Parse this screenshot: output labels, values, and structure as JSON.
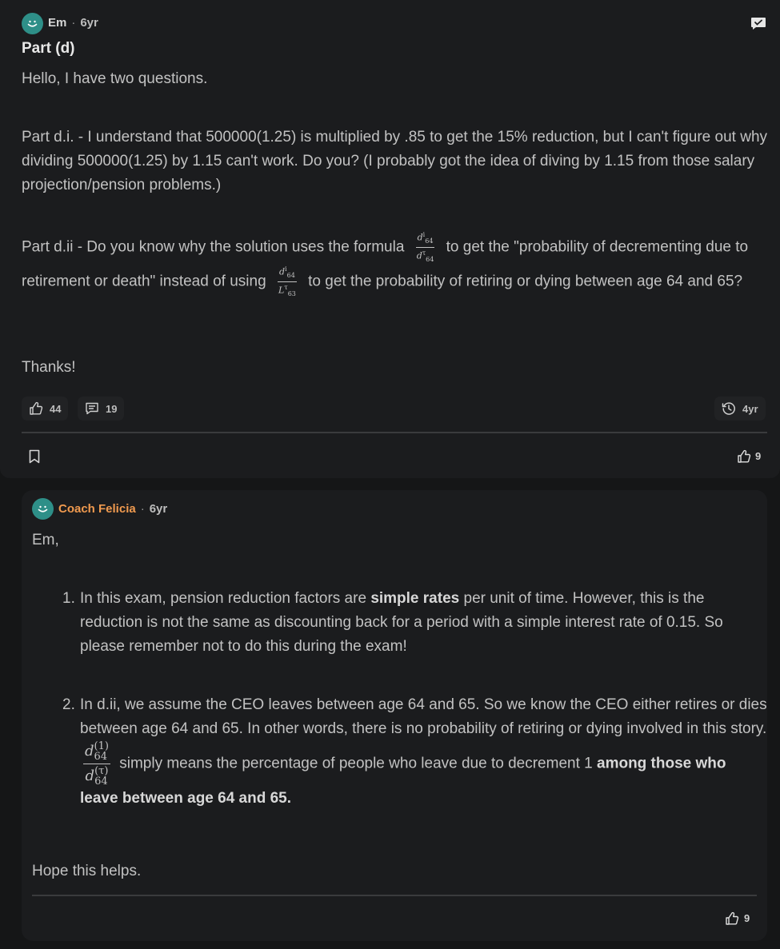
{
  "post": {
    "author": "Em",
    "age": "6yr",
    "title": "Part (d)",
    "greeting": "Hello, I have two questions.",
    "part_i": "Part d.i. - I understand that 500000(1.25) is multiplied by .85 to get the 15% reduction, but I can't figure out why dividing 500000(1.25) by 1.15 can't work. Do you? (I probably got the idea of diving by 1.15 from those salary projection/pension problems.)",
    "part_ii_a": "Part d.ii - Do you know why the solution uses the formula",
    "part_ii_b": "to get the \"probability of decrementing due to retirement or death\" instead of using",
    "part_ii_c": "to get the probability of retiring or dying between age 64 and 65?",
    "formula1_num": "d",
    "formula1_num_sup": "i",
    "formula1_num_sub": "64",
    "formula1_den": "d",
    "formula1_den_sup": "τ",
    "formula1_den_sub": "64",
    "formula2_num": "d",
    "formula2_num_sup": "i",
    "formula2_num_sub": "64",
    "formula2_den": "L",
    "formula2_den_sup": "τ",
    "formula2_den_sub": "63",
    "thanks": "Thanks!",
    "likes": "44",
    "comments": "19",
    "last_activity": "4yr",
    "bottom_likes": "9"
  },
  "reply": {
    "author": "Coach Felicia",
    "age": "6yr",
    "salutation": "Em,",
    "item1_num": "1.",
    "item1_a": "In this exam, pension reduction factors are ",
    "item1_bold": "simple rates",
    "item1_b": " per unit of time. However, this is the reduction is not the same as discounting back for a period with a simple interest rate of 0.15. So please remember not to do this during the exam!",
    "item2_num": "2.",
    "item2_a": "In d.ii, we assume the CEO leaves between age 64 and 65. So we know the CEO either retires or dies between age 64 and 65. In other words, there is no probability of retiring or dying involved in this story.",
    "item2_frac_num": "d",
    "item2_frac_num_sup": "(1)",
    "item2_frac_num_sub": "64",
    "item2_frac_den": "d",
    "item2_frac_den_sup": "(τ)",
    "item2_frac_den_sub": "64",
    "item2_b": " simply means the percentage of people who leave due to decrement 1 ",
    "item2_bold": "among those who leave between age 64 and 65.",
    "closing": "Hope this helps.",
    "likes": "9"
  },
  "icons": {
    "avatar": "smiley-avatar-icon",
    "like": "thumbs-up-icon",
    "comment": "comment-icon",
    "history": "history-icon",
    "bookmark": "bookmark-icon",
    "message": "message-icon"
  },
  "colors": {
    "background": "#151617",
    "card": "#1b1c1e",
    "avatar": "#2e8f88",
    "coach_name": "#f09a4f"
  }
}
